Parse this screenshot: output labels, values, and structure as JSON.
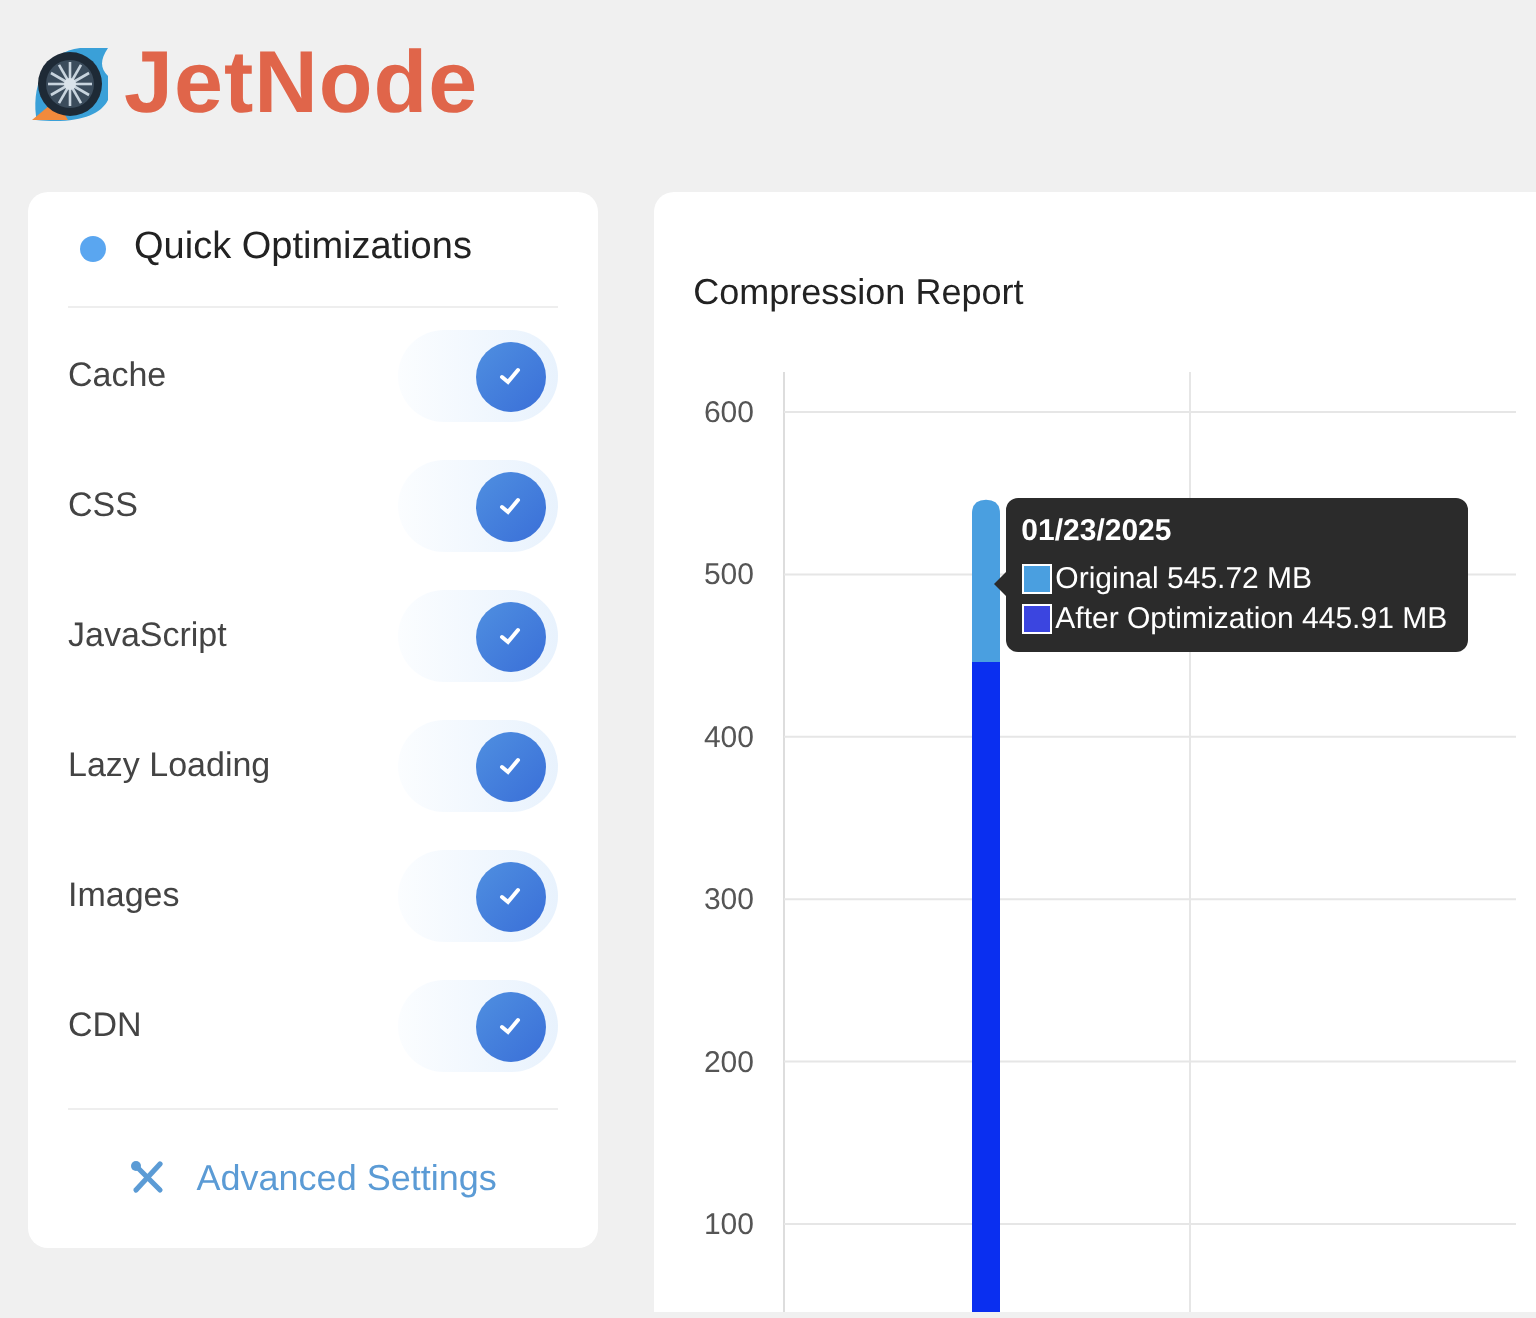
{
  "logo": {
    "text": "JetNode"
  },
  "quick_optimizations": {
    "title": "Quick Optimizations",
    "items": [
      {
        "label": "Cache",
        "checked": true
      },
      {
        "label": "CSS",
        "checked": true
      },
      {
        "label": "JavaScript",
        "checked": true
      },
      {
        "label": "Lazy Loading",
        "checked": true
      },
      {
        "label": "Images",
        "checked": true
      },
      {
        "label": "CDN",
        "checked": true
      }
    ],
    "link": "Advanced Settings"
  },
  "compression_report": {
    "title": "Compression Report",
    "chart_data": {
      "type": "bar",
      "series": [
        {
          "color": "#0a2ff0",
          "values": [
            446
          ]
        },
        {
          "color": "#4a9fe0",
          "values": [
            100
          ]
        }
      ],
      "ylim": [
        0,
        600
      ],
      "yticks": [
        100,
        200,
        300,
        400,
        500,
        600
      ],
      "stacked": true,
      "grid": true
    },
    "tooltip": {
      "title": "01/23/2025",
      "rows": [
        {
          "label": "Original 545.72 MB",
          "color": "#4a9fe0"
        },
        {
          "label": "After Optimization 445.91 MB",
          "color": "#3b45e0"
        }
      ]
    }
  }
}
